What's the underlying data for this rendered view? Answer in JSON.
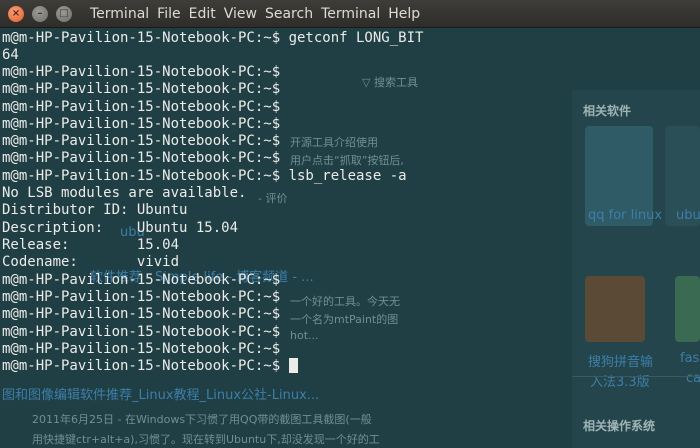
{
  "window": {
    "close_glyph": "×",
    "minimize_glyph": "–",
    "maximize_glyph": "□"
  },
  "menu": [
    "Terminal",
    "File",
    "Edit",
    "View",
    "Search",
    "Terminal",
    "Help"
  ],
  "terminal": {
    "prompt": "m@m-HP-Pavilion-15-Notebook-PC:~$",
    "lines": [
      "m@m-HP-Pavilion-15-Notebook-PC:~$ getconf LONG_BIT",
      "64",
      "m@m-HP-Pavilion-15-Notebook-PC:~$",
      "m@m-HP-Pavilion-15-Notebook-PC:~$",
      "m@m-HP-Pavilion-15-Notebook-PC:~$",
      "m@m-HP-Pavilion-15-Notebook-PC:~$",
      "m@m-HP-Pavilion-15-Notebook-PC:~$",
      "m@m-HP-Pavilion-15-Notebook-PC:~$",
      "m@m-HP-Pavilion-15-Notebook-PC:~$ lsb_release -a",
      "No LSB modules are available.",
      "Distributor ID: Ubuntu",
      "Description:    Ubuntu 15.04",
      "Release:        15.04",
      "Codename:       vivid",
      "m@m-HP-Pavilion-15-Notebook-PC:~$",
      "m@m-HP-Pavilion-15-Notebook-PC:~$",
      "m@m-HP-Pavilion-15-Notebook-PC:~$",
      "m@m-HP-Pavilion-15-Notebook-PC:~$",
      "m@m-HP-Pavilion-15-Notebook-PC:~$",
      "m@m-HP-Pavilion-15-Notebook-PC:~$"
    ]
  },
  "background_page": {
    "search_tools": "▽ 搜索工具",
    "side_title": "相关软件",
    "side_item_1": "qq for linux",
    "side_item_2": "ubu",
    "side_item_3_line1": "搜狗拼音输",
    "side_item_3_line2": "入法3.3版",
    "side_item_4_line1": "fas",
    "side_item_4_line2": "ca",
    "side_section_2": "相关操作系统",
    "snippet_1": "开源工具介绍使用",
    "snippet_2": "用户点击“抓取”按钮后,",
    "snippet_3": "- 评价",
    "link_ubuntu": "ubu",
    "link_2": "软件推荐 - Simple life - 博客频道 - ...",
    "snippet_4": "一个好的工具。今天无",
    "snippet_5": "一个名为mtPaint的图",
    "snippet_6": "hot...",
    "link_bottom": "图和图像编辑软件推荐_Linux教程_Linux公社-Linux...",
    "snippet_date": "2011年6月25日 - 在Windows下习惯了用QQ带的截图工具截图(一般",
    "snippet_last": "用快捷键ctr+alt+a),习惯了。现在转到Ubuntu下,却没发现一个好的工"
  },
  "colors": {
    "terminal_text": "#ecebe7",
    "terminal_bg": "#1f3f45",
    "titlebar": "#3e3d39",
    "link": "#3d7ea8"
  }
}
